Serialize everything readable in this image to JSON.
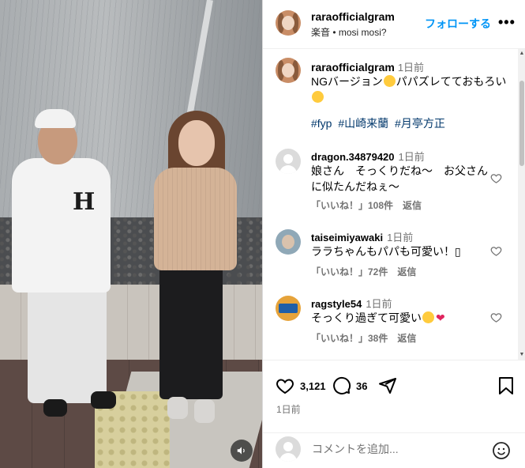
{
  "post_author": {
    "username": "raraofficialgram",
    "subtitle": "楽音 • mosi mosi?",
    "follow_label": "フォローする",
    "more_label": "•••"
  },
  "caption": {
    "username": "raraofficialgram",
    "time": "1日前",
    "text_before": "NGバージョン",
    "text_mid": "パパズレてておもろい",
    "hashtags": [
      "#fyp",
      "#山崎来蘭",
      "#月亭方正"
    ]
  },
  "comments": [
    {
      "username": "dragon.34879420",
      "time": "1日前",
      "text": "娘さん　そっくりだね〜　お父さんに似たんだねぇ〜",
      "likes": "「いいね！」108件",
      "reply": "返信",
      "avatar": "default"
    },
    {
      "username": "taiseimiyawaki",
      "time": "1日前",
      "text": "ララちゃんもパパも可愛い！▯",
      "likes": "「いいね！」72件",
      "reply": "返信",
      "avatar": "photo"
    },
    {
      "username": "ragstyle54",
      "time": "1日前",
      "text": "そっくり過ぎて可愛い",
      "likes": "「いいね！」38件",
      "reply": "返信",
      "avatar": "badge"
    }
  ],
  "actions": {
    "like_count": "3,121",
    "comment_count": "36",
    "post_time": "1日前"
  },
  "compose": {
    "placeholder": "コメントを追加..."
  },
  "icons": [
    "sound-icon",
    "more-icon",
    "heart-icon",
    "comment-icon",
    "share-icon",
    "bookmark-icon",
    "emoji-icon",
    "scroll-up-icon",
    "scroll-down-icon"
  ],
  "colors": {
    "accent": "#0095f6",
    "hashtag": "#00376b",
    "muted": "#737373",
    "heart": "#e0245e"
  }
}
